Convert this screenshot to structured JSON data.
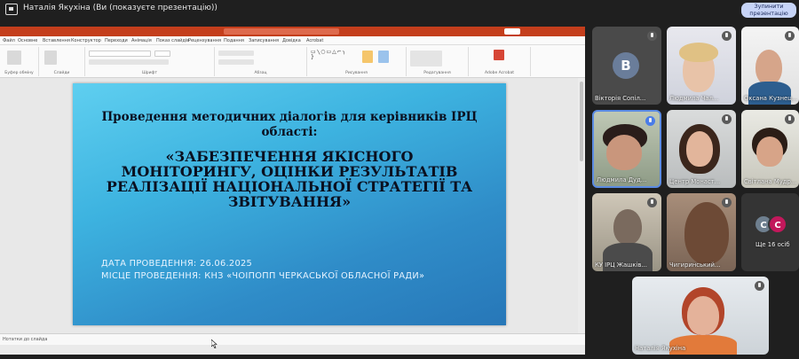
{
  "meeting": {
    "presenter_title": "Наталія Якухіна (Ви (показуєте презентацію))",
    "stop_button": "Зупинити презентацію"
  },
  "ppt": {
    "tabs": [
      "Файл",
      "Основне",
      "Вставлення",
      "Конструктор",
      "Переходи",
      "Анімація",
      "Показ слайдів",
      "Рецензування",
      "Подання",
      "Записування",
      "Довідка",
      "Acrobat"
    ],
    "ribbon_groups": [
      "Буфер обміну",
      "Слайди",
      "Шрифт",
      "Абзац",
      "Рисування",
      "Редагування",
      "Adobe Acrobat"
    ],
    "notes_placeholder": "Нотатки до слайда"
  },
  "slide": {
    "title": "Проведення методичних діалогів для керівників ІРЦ області:",
    "subtitle": "«ЗАБЕЗПЕЧЕННЯ ЯКІСНОГО МОНІТОРИНГУ, ОЦІНКИ РЕЗУЛЬТАТІВ РЕАЛІЗАЦІЇ НАЦІОНАЛЬНОЇ СТРАТЕГІЇ ТА ЗВІТУВАННЯ»",
    "date_line": "ДАТА ПРОВЕДЕННЯ: 26.06.2025",
    "place_line": "МІСЦЕ ПРОВЕДЕННЯ: КНЗ «ЧОІПОПП ЧЕРКАСЬКОЇ ОБЛАСНОЇ РАДИ»"
  },
  "participants": [
    {
      "name": "Вікторія Сопіл...",
      "initial": "В",
      "muted": true
    },
    {
      "name": "Людмила Чал...",
      "muted": true
    },
    {
      "name": "Оксана Кузнец...",
      "muted": true
    },
    {
      "name": "Людмила Дуд...",
      "muted": false,
      "speaking": true
    },
    {
      "name": "Центр Монаст...",
      "muted": true
    },
    {
      "name": "Світлана Мудр...",
      "muted": true
    },
    {
      "name": "КУ ІРЦ Жашків...",
      "muted": true
    },
    {
      "name": "Чигиринський...",
      "muted": true
    },
    {
      "name": "Наталія Якухіна",
      "muted": true
    }
  ],
  "more_participants": {
    "label": "Ще 16 осіб",
    "initials": [
      "С",
      "С"
    ]
  }
}
